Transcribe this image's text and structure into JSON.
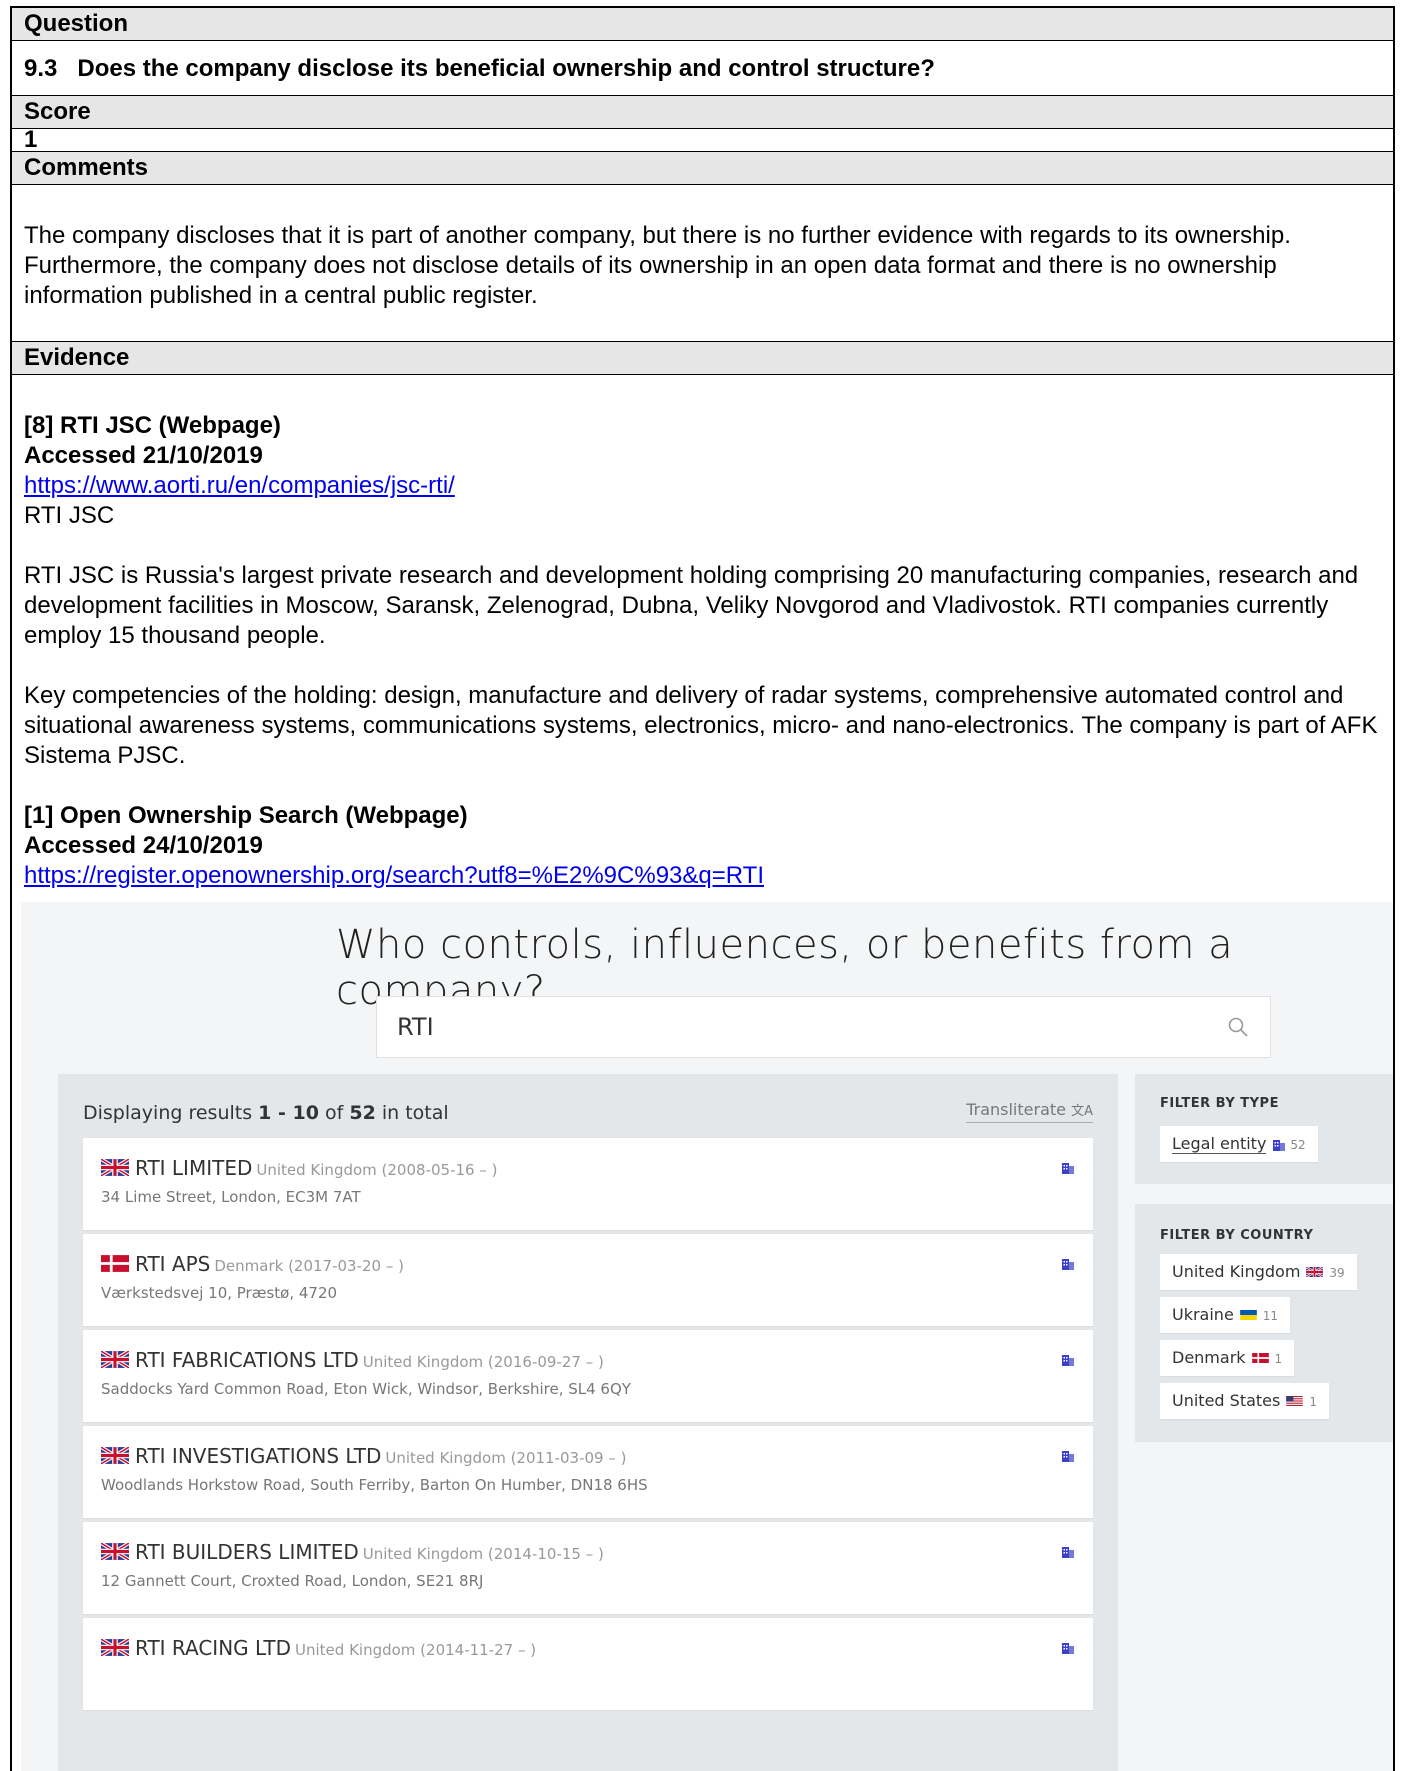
{
  "question_header": "Question",
  "question": "9.3   Does the company disclose its beneficial ownership and control structure?",
  "score_header": "Score",
  "score": "1",
  "comments_header": "Comments",
  "comments": "The company discloses that it is part of another company, but there is no further evidence with regards to its ownership. Furthermore, the company does not disclose details of its ownership in an open data format and there is no ownership information published in a central public register.",
  "evidence_header": "Evidence",
  "ev1": {
    "title": "[8] RTI JSC (Webpage)",
    "accessed": "Accessed 21/10/2019",
    "url": "https://www.aorti.ru/en/companies/jsc-rti/",
    "name": "RTI JSC",
    "p1": "RTI JSC is Russia's largest private research and development holding comprising 20 manufacturing companies, research and development facilities in Moscow, Saransk, Zelenograd, Dubna, Veliky Novgorod and Vladivostok. RTI companies currently employ 15 thousand people.",
    "p2": "Key competencies of the holding: design, manufacture and delivery of radar systems, comprehensive automated control and situational awareness systems, communications systems, electronics, micro- and nano-electronics. The company is part of AFK Sistema PJSC."
  },
  "ev2": {
    "title": "[1] Open Ownership Search (Webpage)",
    "accessed": "Accessed 24/10/2019",
    "url": "https://register.openownership.org/search?utf8=%E2%9C%93&q=RTI"
  },
  "shot": {
    "title": "Who controls, influences, or benefits from a company?",
    "search_value": "RTI",
    "results_prefix": "Displaying results ",
    "results_range": "1 - 10",
    "results_of": " of ",
    "results_total": "52",
    "results_suffix": " in total",
    "transliterate": "Transliterate",
    "results": [
      {
        "name": "RTI LIMITED",
        "meta": "United Kingdom (2008-05-16 – )",
        "addr": "34 Lime Street, London, EC3M 7AT",
        "flag": "uk"
      },
      {
        "name": "RTI APS",
        "meta": "Denmark (2017-03-20 – )",
        "addr": "Værkstedsvej 10, Præstø, 4720",
        "flag": "dk"
      },
      {
        "name": "RTI FABRICATIONS LTD",
        "meta": "United Kingdom (2016-09-27 – )",
        "addr": "Saddocks Yard Common Road, Eton Wick, Windsor, Berkshire, SL4 6QY",
        "flag": "uk"
      },
      {
        "name": "RTI INVESTIGATIONS LTD",
        "meta": "United Kingdom (2011-03-09 – )",
        "addr": "Woodlands Horkstow Road, South Ferriby, Barton On Humber, DN18 6HS",
        "flag": "uk"
      },
      {
        "name": "RTI BUILDERS LIMITED",
        "meta": "United Kingdom (2014-10-15 – )",
        "addr": "12 Gannett Court, Croxted Road, London, SE21 8RJ",
        "flag": "uk"
      },
      {
        "name": "RTI RACING LTD",
        "meta": "United Kingdom (2014-11-27 – )",
        "addr": "",
        "flag": "uk"
      }
    ],
    "filter_type_title": "FILTER BY TYPE",
    "filter_type": [
      {
        "label": "Legal entity",
        "count": "52"
      }
    ],
    "filter_country_title": "FILTER BY COUNTRY",
    "filter_country": [
      {
        "label": "United Kingdom",
        "count": "39",
        "flag": "uk"
      },
      {
        "label": "Ukraine",
        "count": "11",
        "flag": "ua"
      },
      {
        "label": "Denmark",
        "count": "1",
        "flag": "dk"
      },
      {
        "label": "United States",
        "count": "1",
        "flag": "us"
      }
    ],
    "colors": {
      "link": "#0000ee",
      "building_icon": "#3b3fc9",
      "panel": "#e4e7ea"
    }
  }
}
